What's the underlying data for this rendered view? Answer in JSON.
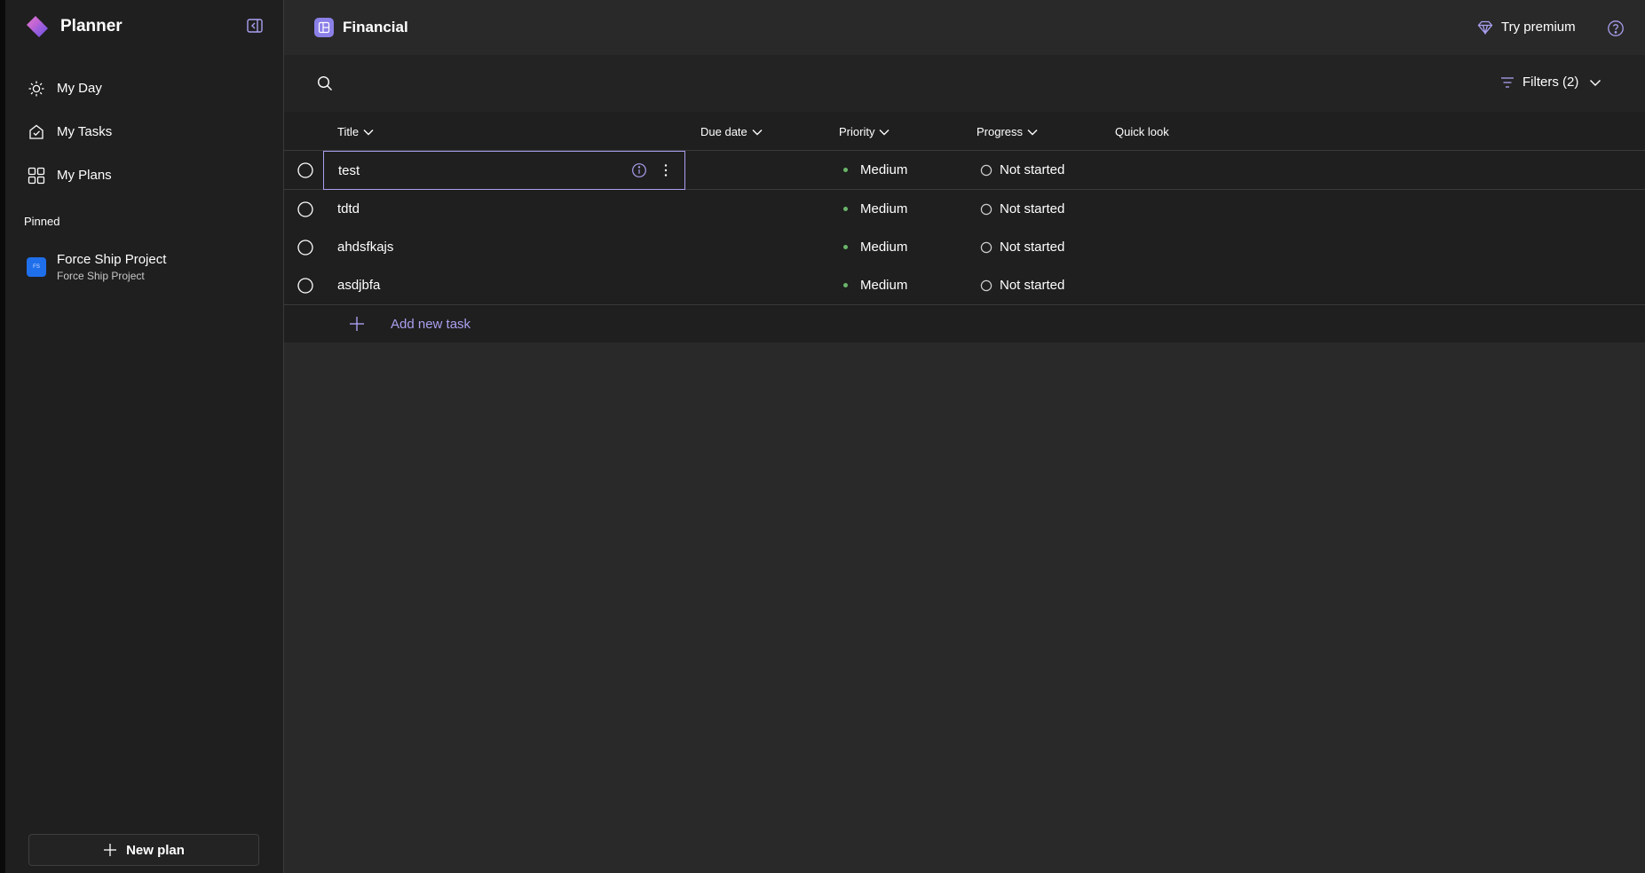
{
  "app": {
    "name": "Planner"
  },
  "sidebar": {
    "nav": [
      {
        "label": "My Day",
        "icon": "sun-icon"
      },
      {
        "label": "My Tasks",
        "icon": "tasks-icon"
      },
      {
        "label": "My Plans",
        "icon": "plans-grid-icon"
      }
    ],
    "pinned_header": "Pinned",
    "pinned": [
      {
        "badge": "FS",
        "title": "Force Ship Project",
        "subtitle": "Force Ship Project"
      }
    ],
    "new_plan_label": "New plan"
  },
  "header": {
    "plan_title": "Financial",
    "premium_label": "Try premium"
  },
  "toolbar": {
    "search_placeholder": "",
    "filters_label": "Filters (2)"
  },
  "grid": {
    "columns": {
      "title": "Title",
      "due_date": "Due date",
      "priority": "Priority",
      "progress": "Progress",
      "quick_look": "Quick look"
    },
    "rows": [
      {
        "title": "test",
        "due_date": "",
        "priority": "Medium",
        "progress": "Not started"
      },
      {
        "title": "tdtd",
        "due_date": "",
        "priority": "Medium",
        "progress": "Not started"
      },
      {
        "title": "ahdsfkajs",
        "due_date": "",
        "priority": "Medium",
        "progress": "Not started"
      },
      {
        "title": "asdjbfa",
        "due_date": "",
        "priority": "Medium",
        "progress": "Not started"
      }
    ],
    "add_task_label": "Add new task"
  },
  "colors": {
    "accent": "#a9a0f0",
    "priority_medium": "#6ab56a",
    "pinned_badge": "#1f6feb",
    "background": "#292929",
    "sidebar_bg": "#1f1f1f"
  }
}
